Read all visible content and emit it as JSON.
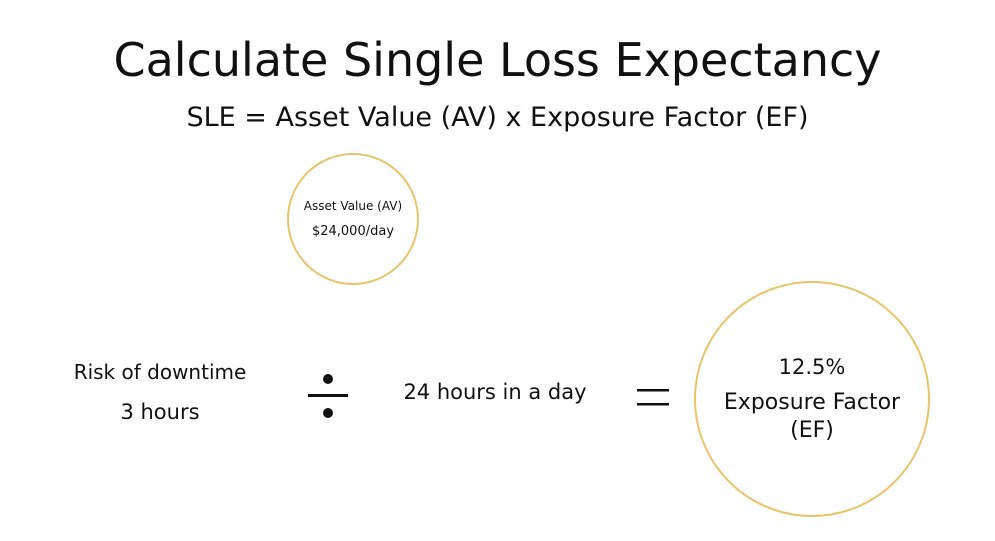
{
  "title": "Calculate Single Loss Expectancy",
  "formula": "SLE = Asset Value (AV) x Exposure Factor (EF)",
  "asset_value": {
    "label": "Asset Value (AV)",
    "value": "$24,000/day"
  },
  "risk": {
    "label": "Risk of downtime",
    "value": "3 hours"
  },
  "operators": {
    "divide": "divide-icon",
    "equals": "equals-icon"
  },
  "divisor": "24 hours in a day",
  "exposure_factor": {
    "percent": "12.5%",
    "label": "Exposure Factor",
    "abbr": "(EF)"
  },
  "colors": {
    "circle_border": "#e9c46a",
    "text": "#111111"
  }
}
